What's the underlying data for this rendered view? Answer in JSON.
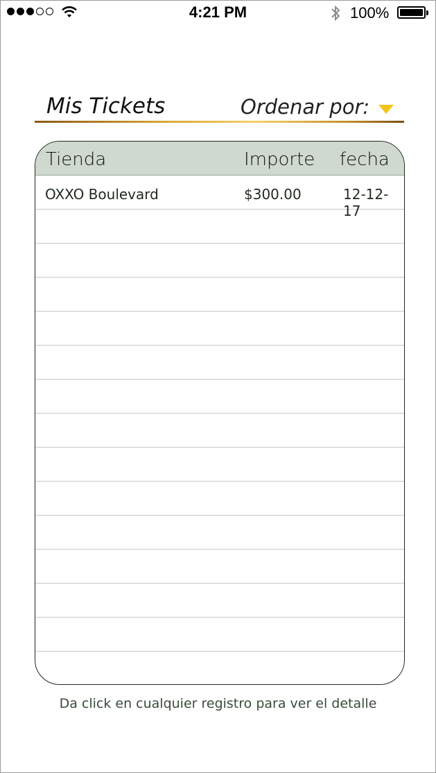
{
  "status_bar": {
    "time": "4:21 PM",
    "battery_percent": "100%",
    "signal_bars_filled": 3,
    "signal_bars_total": 5,
    "icons": [
      "wifi-icon",
      "bluetooth-icon",
      "battery-icon"
    ]
  },
  "header": {
    "title": "Mis Tickets",
    "sort_label": "Ordenar por:",
    "accent_color": "#f2c51a"
  },
  "table": {
    "columns": [
      "Tienda",
      "Importe",
      "fecha"
    ],
    "rows": [
      {
        "tienda": "OXXO Boulevard",
        "importe": "$300.00",
        "fecha": "12-12-17"
      }
    ],
    "empty_rows": 14,
    "header_color": "#cfd9cf"
  },
  "footer": {
    "hint": "Da click en cualquier registro para ver el detalle"
  }
}
